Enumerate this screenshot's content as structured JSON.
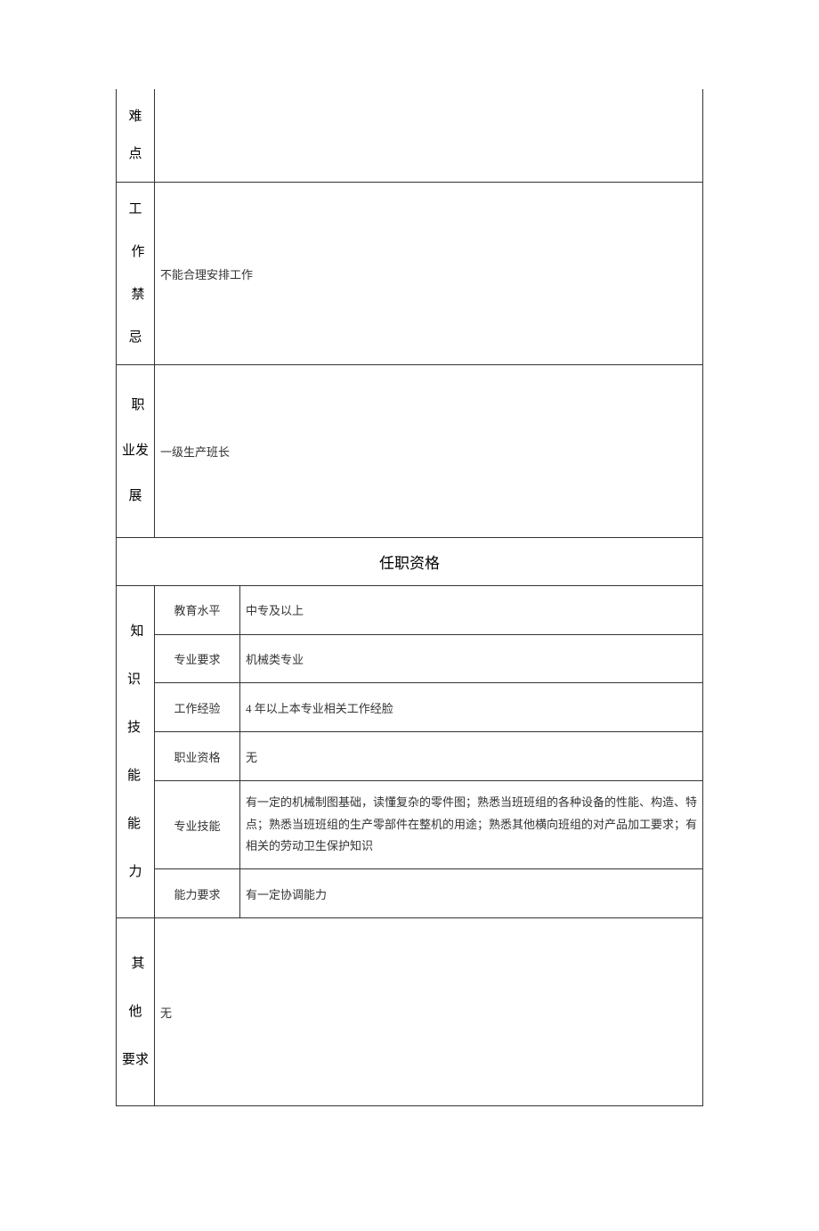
{
  "rows": {
    "difficulty": {
      "label_chars": [
        "难",
        "点"
      ],
      "value": ""
    },
    "taboo": {
      "label_chars": [
        "工",
        "作",
        "禁",
        "忌"
      ],
      "value": "不能合理安排工作"
    },
    "career": {
      "label_chars": [
        "职",
        "业发",
        "展"
      ],
      "value": "一级生产班长"
    }
  },
  "qualification_header": "任职资格",
  "knowledge": {
    "label_chars": [
      "知",
      "识 技",
      "能 能",
      "力"
    ],
    "items": {
      "education": {
        "label": "教育水平",
        "value": "中专及以上"
      },
      "major": {
        "label": "专业要求",
        "value": "机械类专业"
      },
      "experience": {
        "label": "工作经验",
        "value": "4 年以上本专业相关工作经脸"
      },
      "certificate": {
        "label": "职业资格",
        "value": "无"
      },
      "skills": {
        "label": "专业技能",
        "value": "有一定的机械制图基础，读懂复杂的零件图；熟悉当班班组的各种设备的性能、构造、特点；熟悉当班班组的生产零部件在整机的用途；熟悉其他横向班组的对产品加工要求；有相关的劳动卫生保护知识"
      },
      "ability": {
        "label": "能力要求",
        "value": "有一定协调能力"
      }
    }
  },
  "other": {
    "label_chars": [
      "其",
      "他",
      "要求"
    ],
    "value": "无"
  }
}
